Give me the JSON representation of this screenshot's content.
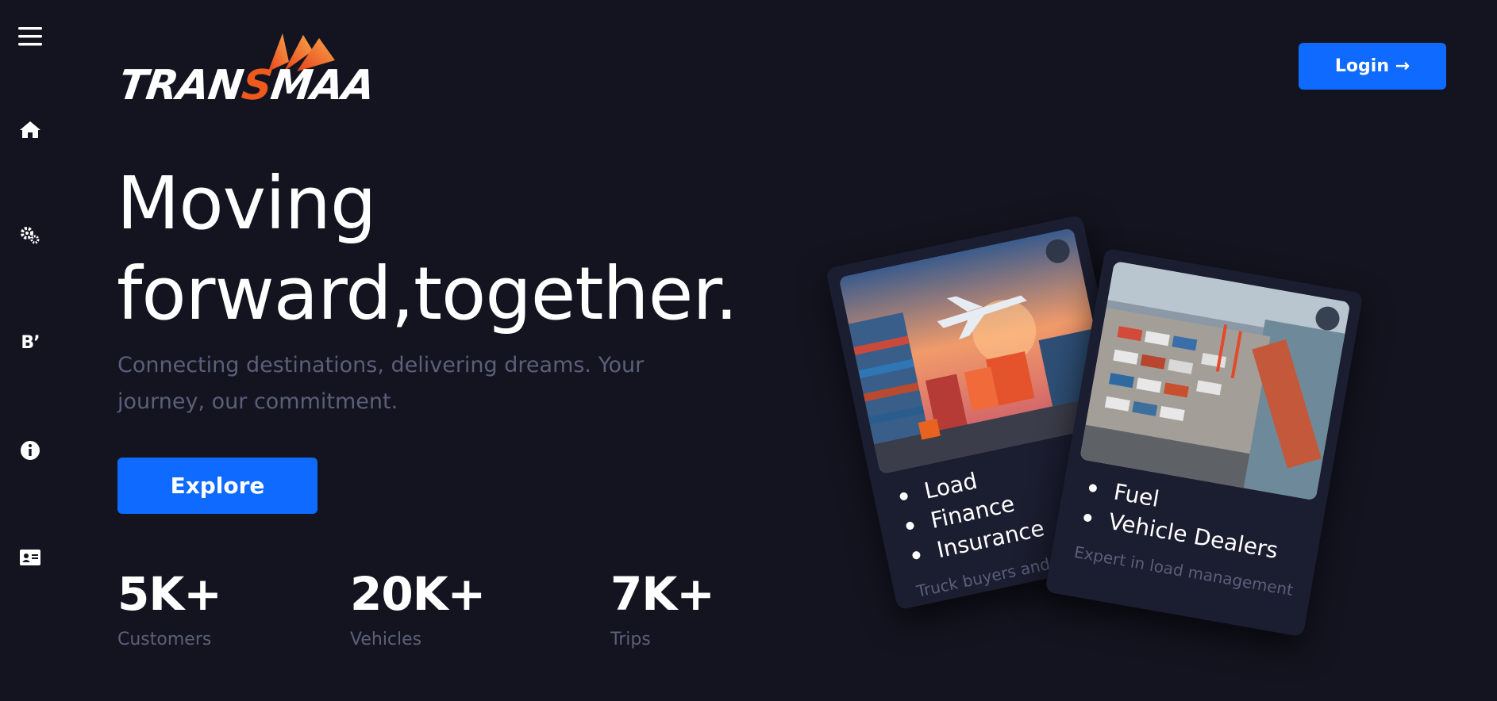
{
  "brand": {
    "logo_text_1": "TRAN",
    "logo_text_2": "S",
    "logo_text_3": "MAA",
    "accent": "#0f6bff",
    "logo_orange": "#ee5a1d",
    "background": "#13141f"
  },
  "sidebar": {
    "items": [
      {
        "icon": "hamburger-menu-icon"
      },
      {
        "icon": "home-icon"
      },
      {
        "icon": "gears-icon"
      },
      {
        "icon": "blog-icon",
        "label": "B’"
      },
      {
        "icon": "info-icon"
      },
      {
        "icon": "contact-card-icon"
      }
    ]
  },
  "header": {
    "login_label": "Login →"
  },
  "hero": {
    "title_line1": "Moving",
    "title_line2": "forward,together.",
    "subtitle": "Connecting destinations, delivering dreams. Your journey, our commitment.",
    "explore_label": "Explore"
  },
  "stats": [
    {
      "value": "5K+",
      "label": "Customers"
    },
    {
      "value": "20K+",
      "label": "Vehicles"
    },
    {
      "value": "7K+",
      "label": "Trips"
    }
  ],
  "cards": [
    {
      "items": [
        "Load",
        "Finance",
        "Insurance"
      ],
      "description": "Truck buyers and sell",
      "image": "logistics-cargo-plane-truck"
    },
    {
      "items": [
        "Fuel",
        "Vehicle Dealers"
      ],
      "description": "Expert in load management",
      "image": "container-port-aerial"
    }
  ]
}
